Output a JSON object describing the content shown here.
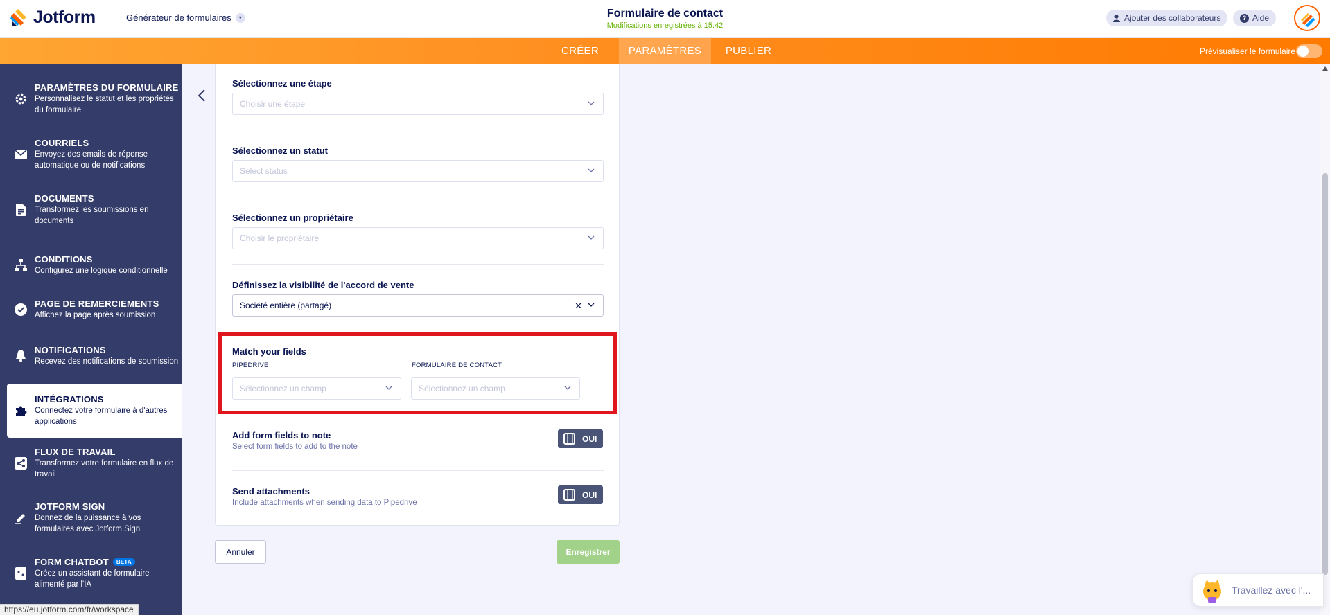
{
  "header": {
    "logo_text": "Jotform",
    "builder_label": "Générateur de formulaires",
    "form_title": "Formulaire de contact",
    "saved_status": "Modifications enregistrées à 15:42",
    "collab_label": "Ajouter des collaborateurs",
    "help_label": "Aide"
  },
  "nav": {
    "tabs": [
      {
        "label": "CRÉER"
      },
      {
        "label": "PARAMÈTRES"
      },
      {
        "label": "PUBLIER"
      }
    ],
    "preview_label": "Prévisualiser le formulaire"
  },
  "sidebar": {
    "items": [
      {
        "title": "PARAMÈTRES DU FORMULAIRE",
        "desc": "Personnalisez le statut et les propriétés du formulaire",
        "icon": "gear-icon"
      },
      {
        "title": "COURRIELS",
        "desc": "Envoyez des emails de réponse automatique ou de notifications",
        "icon": "envelope-icon"
      },
      {
        "title": "DOCUMENTS",
        "desc": "Transformez les soumissions en documents",
        "icon": "document-icon"
      },
      {
        "title": "CONDITIONS",
        "desc": "Configurez une logique conditionnelle",
        "icon": "sitemap-icon"
      },
      {
        "title": "PAGE DE REMERCIEMENTS",
        "desc": "Affichez la page après soumission",
        "icon": "check-circle-icon"
      },
      {
        "title": "NOTIFICATIONS",
        "desc": "Recevez des notifications de soumission",
        "icon": "bell-icon"
      },
      {
        "title": "INTÉGRATIONS",
        "desc": "Connectez votre formulaire à d'autres applications",
        "icon": "puzzle-icon"
      },
      {
        "title": "FLUX DE TRAVAIL",
        "desc": "Transformez votre formulaire en flux de travail",
        "icon": "workflow-icon"
      },
      {
        "title": "JOTFORM SIGN",
        "desc": "Donnez de la puissance à vos formulaires avec Jotform Sign",
        "icon": "pen-icon"
      },
      {
        "title": "FORM CHATBOT",
        "badge": "BETA",
        "desc": "Créez un assistant de formulaire alimenté par l'IA",
        "icon": "chatbot-icon"
      }
    ]
  },
  "form": {
    "stage_label": "Sélectionnez une étape",
    "stage_placeholder": "Choisir une étape",
    "status_label": "Sélectionnez un statut",
    "status_placeholder": "Select status",
    "owner_label": "Sélectionnez un propriétaire",
    "owner_placeholder": "Choisir le propriétaire",
    "visibility_label": "Définissez la visibilité de l'accord de vente",
    "visibility_value": "Société entière (partagé)",
    "match_title": "Match your fields",
    "match_left_header": "PIPEDRIVE",
    "match_right_header": "FORMULAIRE DE CONTACT",
    "match_left_placeholder": "Sélectionnez un champ",
    "match_right_placeholder": "Sélectionnez un champ",
    "note_title": "Add form fields to note",
    "note_desc": "Select form fields to add to the note",
    "note_toggle": "OUI",
    "attach_title": "Send attachments",
    "attach_desc": "Include attachments when sending data to Pipedrive",
    "attach_toggle": "OUI"
  },
  "actions": {
    "cancel_label": "Annuler",
    "save_label": "Enregistrer"
  },
  "status_bar_url": "https://eu.jotform.com/fr/workspace",
  "chat_widget_text": "Travaillez avec l'...",
  "colors": {
    "accent_orange": "#ff7a00",
    "sidebar_bg": "#343c6a",
    "highlight_red": "#e0161e",
    "save_green": "#a2d18a"
  }
}
